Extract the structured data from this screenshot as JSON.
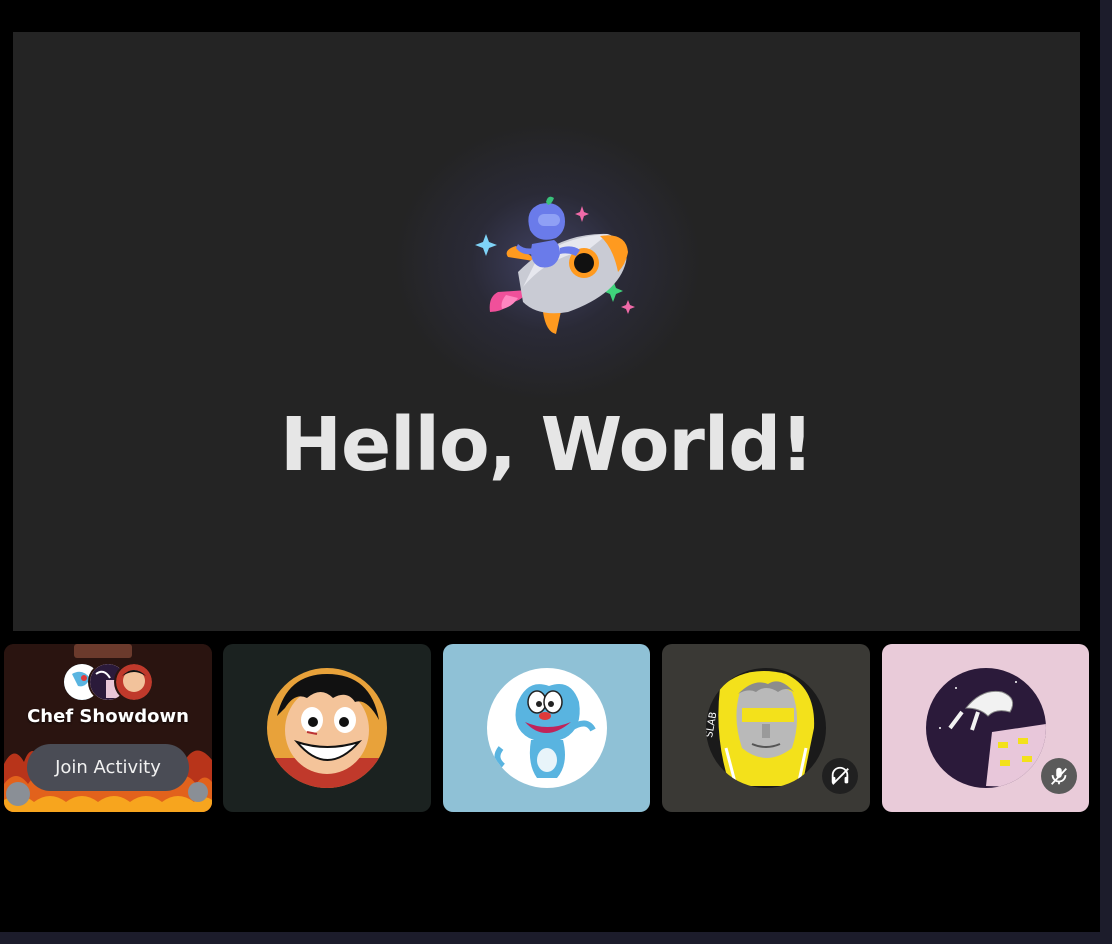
{
  "stage": {
    "greeting": "Hello, World!",
    "illustration": "rocket-mascot-icon"
  },
  "activity": {
    "title": "Chef Showdown",
    "join_label": "Join Activity",
    "participants": [
      "participant-avatar-1",
      "participant-avatar-2",
      "participant-avatar-3"
    ]
  },
  "participants": [
    {
      "avatar": "anime-boy-avatar",
      "tile_color": "#1b2220",
      "status": null
    },
    {
      "avatar": "cartoon-cat-avatar",
      "tile_color": "#8fc1d6",
      "status": null
    },
    {
      "avatar": "statue-avatar",
      "tile_color": "#3a3935",
      "status": "deafened-icon"
    },
    {
      "avatar": "sketch-hand-avatar",
      "tile_color": "#e9cbd9",
      "status": "muted-icon"
    }
  ],
  "colors": {
    "background": "#000000",
    "stage": "#242424",
    "button": "#4a4c55"
  }
}
